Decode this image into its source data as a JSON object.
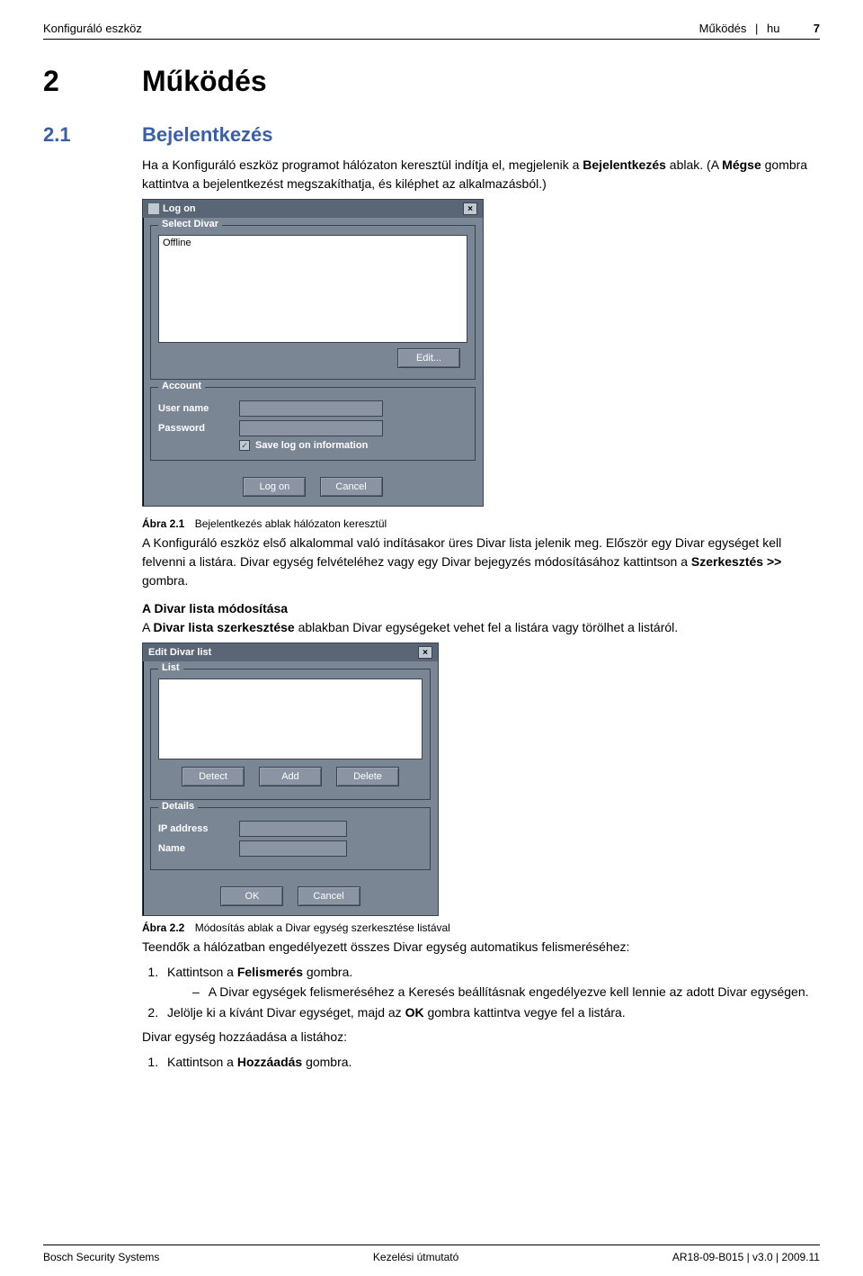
{
  "header": {
    "left": "Konfiguráló eszköz",
    "right_section": "Működés",
    "right_lang": "hu",
    "page_no": "7"
  },
  "section": {
    "num": "2",
    "title": "Működés"
  },
  "subsection": {
    "num": "2.1",
    "title": "Bejelentkezés"
  },
  "intro": {
    "p1a": "Ha a Konfiguráló eszköz programot hálózaton keresztül indítja el, megjelenik a ",
    "p1b": "Bejelentkezés",
    "p1c": " ablak. (A ",
    "p1d": "Mégse",
    "p1e": " gombra kattintva a bejelentkezést megszakíthatja, és kiléphet az alkalmazásból.)"
  },
  "dialog1": {
    "title": "Log on",
    "group_select": "Select Divar",
    "list_item": "Offline",
    "edit_btn": "Edit...",
    "group_account": "Account",
    "user_label": "User name",
    "pass_label": "Password",
    "save_check": "Save log on information",
    "logon_btn": "Log on",
    "cancel_btn": "Cancel"
  },
  "figure1": {
    "label": "Ábra 2.1",
    "caption": "Bejelentkezés ablak hálózaton keresztül"
  },
  "after_fig1": {
    "p1": "A Konfiguráló eszköz első alkalommal való indításakor üres Divar lista jelenik meg. Először egy Divar egységet kell felvenni a listára. Divar egység felvételéhez vagy egy Divar bejegyzés módosításához kattintson a ",
    "p1b": "Szerkesztés >>",
    "p1c": " gombra.",
    "h": "A Divar lista módosítása",
    "p2a": "A ",
    "p2b": "Divar lista szerkesztése",
    "p2c": " ablakban Divar egységeket vehet fel a listára vagy törölhet a listáról."
  },
  "dialog2": {
    "title": "Edit Divar list",
    "group_list": "List",
    "detect_btn": "Detect",
    "add_btn": "Add",
    "delete_btn": "Delete",
    "group_details": "Details",
    "ip_label": "IP address",
    "name_label": "Name",
    "ok_btn": "OK",
    "cancel_btn": "Cancel"
  },
  "figure2": {
    "label": "Ábra 2.2",
    "caption": "Módosítás ablak a Divar egység szerkesztése listával"
  },
  "after_fig2": {
    "lead": "Teendők a hálózatban engedélyezett összes Divar egység automatikus felismeréséhez:",
    "step1a": "Kattintson a ",
    "step1b": "Felismerés",
    "step1c": " gombra.",
    "sub1": "A Divar egységek felismeréséhez a Keresés beállításnak engedélyezve kell lennie az adott Divar egységen.",
    "step2a": "Jelölje ki a kívánt Divar egységet, majd az ",
    "step2b": "OK",
    "step2c": " gombra kattintva vegye fel a listára.",
    "lead2": "Divar egység hozzáadása a listához:",
    "stepB1a": "Kattintson a ",
    "stepB1b": "Hozzáadás",
    "stepB1c": " gombra."
  },
  "footer": {
    "left": "Bosch Security Systems",
    "center": "Kezelési útmutató",
    "right": "AR18-09-B015 | v3.0 | 2009.11"
  }
}
